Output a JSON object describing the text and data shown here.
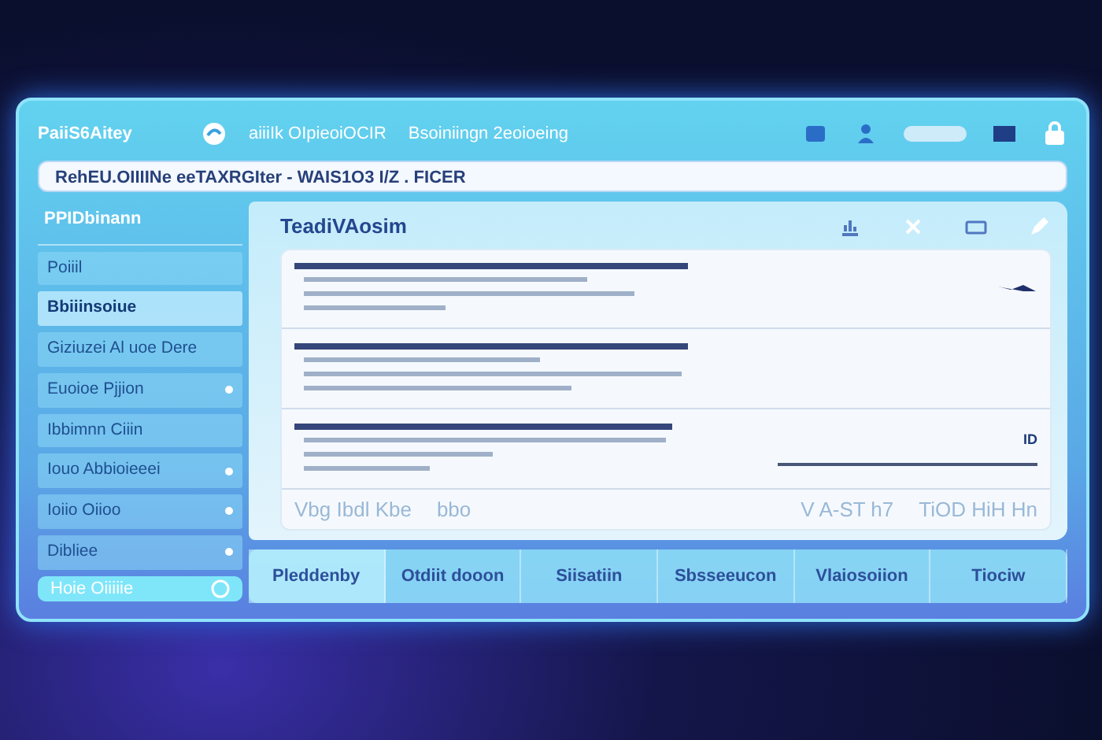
{
  "window": {
    "title": "PaiiS6Aitey",
    "app_name": "aiiiIk OIpieoiOCIR",
    "subtitle": "Bsoiniingn 2eoioeing"
  },
  "address_bar": {
    "value": "RehEU.OIIIINe eeTAXRGIter - WAIS1O3 I/Z . FICER"
  },
  "sidebar": {
    "title": "PPIDbinann",
    "items": [
      {
        "label": "Poiiil",
        "kind": "plain",
        "selected": false
      },
      {
        "label": "Bbiiinsoiue",
        "kind": "plain",
        "selected": true
      },
      {
        "label": "Giziuzei Al uoe Dere",
        "kind": "plain",
        "selected": false
      },
      {
        "label": "Euoioe Pjjion",
        "kind": "dot",
        "selected": false
      },
      {
        "label": "Ibbimnn Ciiin",
        "kind": "plain",
        "selected": false
      },
      {
        "label": "Iouo Abbioieeei",
        "kind": "dot",
        "selected": false
      },
      {
        "label": "Ioiio Oiioo",
        "kind": "dot",
        "selected": false
      },
      {
        "label": "Dibliee",
        "kind": "dot",
        "selected": false
      }
    ],
    "footer_button": "Hoie Oiiiiie"
  },
  "panel": {
    "title": "TeadiVAosim",
    "footer_left": [
      "Vbg Ibdl Kbe",
      "bbo"
    ],
    "footer_right": [
      "V A-ST h7",
      "TiOD HiH Hn"
    ],
    "reading": "ID"
  },
  "tabs": [
    {
      "label": "Pleddenby",
      "selected": true
    },
    {
      "label": "Otdiit dooon",
      "selected": false
    },
    {
      "label": "Siisatiin",
      "selected": false
    },
    {
      "label": "Sbsseeucon",
      "selected": false
    },
    {
      "label": "Vlaiosoiion",
      "selected": false
    },
    {
      "label": "Tiociw",
      "selected": false
    }
  ]
}
